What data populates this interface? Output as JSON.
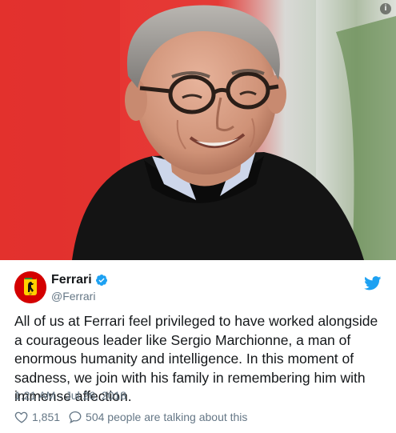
{
  "media": {
    "info_badge": "i",
    "background_color": "#e32b2b",
    "alt_subject": "portrait"
  },
  "tweet": {
    "display_name": "Ferrari",
    "handle": "@Ferrari",
    "verified_icon": "verified-badge-icon",
    "brand_icon": "twitter-bird-icon",
    "text": "All of us at Ferrari feel privileged to have worked alongside a courageous leader like Sergio Marchionne, a man of enormous humanity and intelligence. In this moment of sadness, we join with his family in remembering him with immense affection.",
    "timestamp": "1:21 AM - Jul 26, 2018",
    "likes": "1,851",
    "replies_label": "504 people are talking about this"
  },
  "colors": {
    "accent": "#1da1f2",
    "text": "#14171a",
    "muted": "#657786",
    "ferrari_red": "#d40000",
    "ferrari_yellow": "#ffd100"
  }
}
